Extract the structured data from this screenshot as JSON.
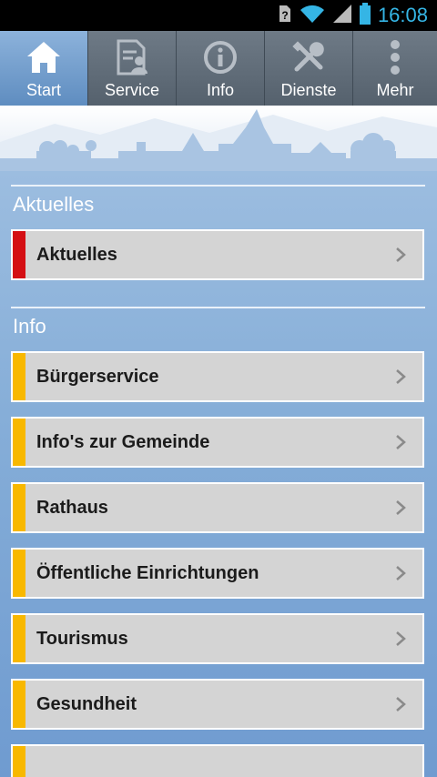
{
  "status_bar": {
    "time": "16:08",
    "icons": [
      "unknown-sim-icon",
      "wifi-icon",
      "signal-icon",
      "battery-icon"
    ],
    "accent": "#35b5e5"
  },
  "tabs": [
    {
      "label": "Start",
      "icon": "home-icon",
      "active": true
    },
    {
      "label": "Service",
      "icon": "document-person-icon",
      "active": false
    },
    {
      "label": "Info",
      "icon": "info-icon",
      "active": false
    },
    {
      "label": "Dienste",
      "icon": "tools-icon",
      "active": false
    },
    {
      "label": "Mehr",
      "icon": "more-vertical-icon",
      "active": false
    }
  ],
  "sections": [
    {
      "title": "Aktuelles",
      "items": [
        {
          "label": "Aktuelles",
          "color": "#d40f14"
        }
      ]
    },
    {
      "title": "Info",
      "items": [
        {
          "label": "Bürgerservice",
          "color": "#f8b800"
        },
        {
          "label": "Info's zur Gemeinde",
          "color": "#f8b800"
        },
        {
          "label": "Rathaus",
          "color": "#f8b800"
        },
        {
          "label": "Öffentliche Einrichtungen",
          "color": "#f8b800"
        },
        {
          "label": "Tourismus",
          "color": "#f8b800"
        },
        {
          "label": "Gesundheit",
          "color": "#f8b800"
        }
      ]
    }
  ]
}
